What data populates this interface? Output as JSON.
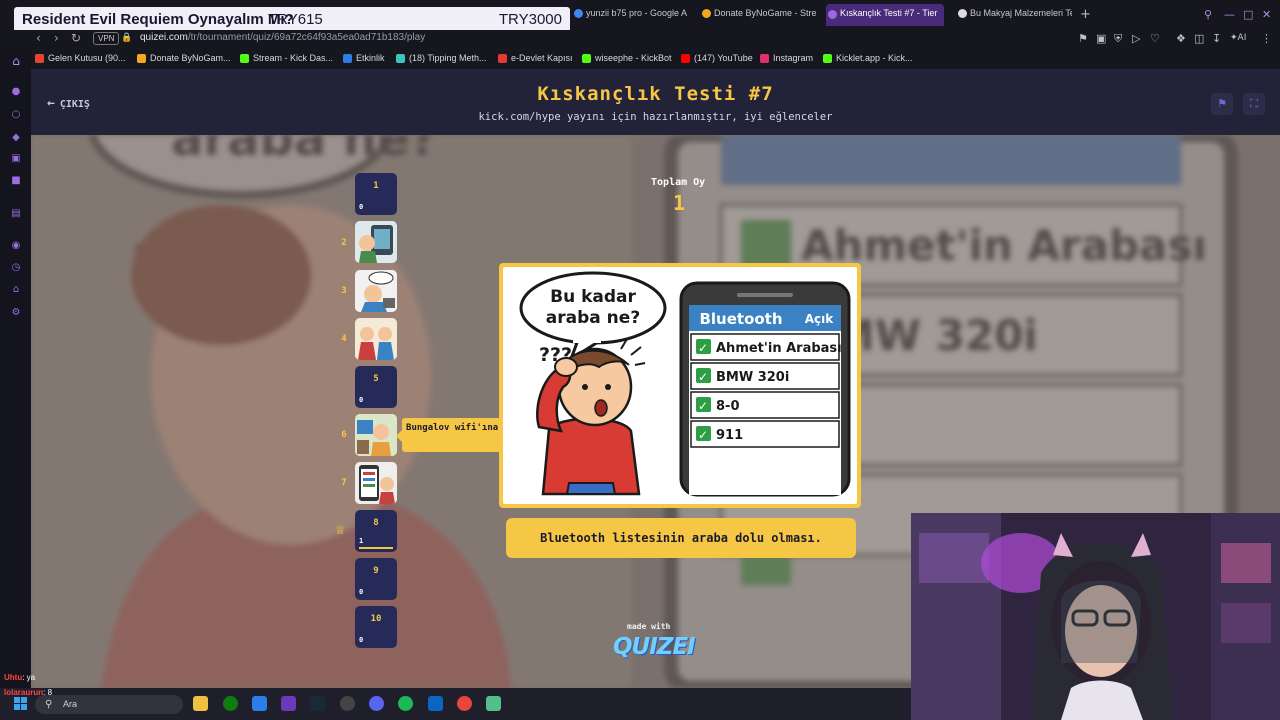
{
  "stream_banner": {
    "title": "Resident Evil Requiem Oynayalım Mı?",
    "code1": "TRY615",
    "code2": "TRY3000"
  },
  "tabs": [
    {
      "label": "yunzii b75 pro - Google A",
      "color": "#4285f4"
    },
    {
      "label": "Donate ByNoGame - Strea",
      "color": "#f5a623"
    },
    {
      "label": "Kıskançlık Testi #7 - Tier",
      "color": "#9c6ade"
    },
    {
      "label": "Bu Makyaj Malzemeleri Te",
      "color": "#dddddd"
    }
  ],
  "url": {
    "vpn": "VPN",
    "host": "quizei.com",
    "path": "/tr/tournament/quiz/69a72c64f93a5ea0ad71b183/play"
  },
  "bookmarks": [
    {
      "label": "Gelen Kutusu (90...",
      "color": "#ea4335"
    },
    {
      "label": "Donate ByNoGam...",
      "color": "#f5a623"
    },
    {
      "label": "Stream - Kick Das...",
      "color": "#53fc18"
    },
    {
      "label": "Etkinlik",
      "color": "#2f7de1"
    },
    {
      "label": "(18) Tipping Meth...",
      "color": "#39c5bb"
    },
    {
      "label": "e-Devlet Kapısı",
      "color": "#e53935"
    },
    {
      "label": "wiseephe - KickBot",
      "color": "#53fc18"
    },
    {
      "label": "(147) YouTube",
      "color": "#ff0000"
    },
    {
      "label": "Instagram",
      "color": "#e1306c"
    },
    {
      "label": "Kicklet.app - Kick...",
      "color": "#53fc18"
    }
  ],
  "header": {
    "exit_label": "ÇIKIŞ",
    "title": "Kıskançlık Testi #7",
    "subtitle": "kick.com/hype yayını için hazırlanmıştır, iyi eğlenceler"
  },
  "bracket": [
    {
      "num": "1",
      "votes": "0",
      "has_image": false
    },
    {
      "num": "2",
      "votes": "",
      "has_image": true
    },
    {
      "num": "3",
      "votes": "",
      "has_image": true
    },
    {
      "num": "4",
      "votes": "",
      "has_image": true
    },
    {
      "num": "5",
      "votes": "0",
      "has_image": false
    },
    {
      "num": "6",
      "votes": "",
      "has_image": true
    },
    {
      "num": "7",
      "votes": "",
      "has_image": true
    },
    {
      "num": "8",
      "votes": "1",
      "has_image": false,
      "leader": true,
      "share": 1.0
    },
    {
      "num": "9",
      "votes": "0",
      "has_image": false
    },
    {
      "num": "10",
      "votes": "0",
      "has_image": false
    }
  ],
  "tooltip": "Bungalov wifi'ına otomatik bağlanması.",
  "total": {
    "label": "Toplam Oy",
    "value": "1"
  },
  "card_art": {
    "bubble_line1": "Bu kadar",
    "bubble_line2": "araba ne?",
    "question_marks": "???",
    "phone_header": "Bluetooth",
    "phone_status": "Açık",
    "items": [
      "Ahmet'in Arabası",
      "BMW 320i",
      "8-0",
      "911"
    ]
  },
  "caption": "Bluetooth listesinin araba dolu olması.",
  "footer": {
    "made_with": "made with",
    "brand": "QUIZEI"
  },
  "chat": [
    {
      "user": "Uhtu",
      "text": ": ya"
    },
    {
      "user": "lolaraurun",
      "text": ": 8"
    }
  ],
  "taskbar": {
    "search_placeholder": "Ara"
  }
}
